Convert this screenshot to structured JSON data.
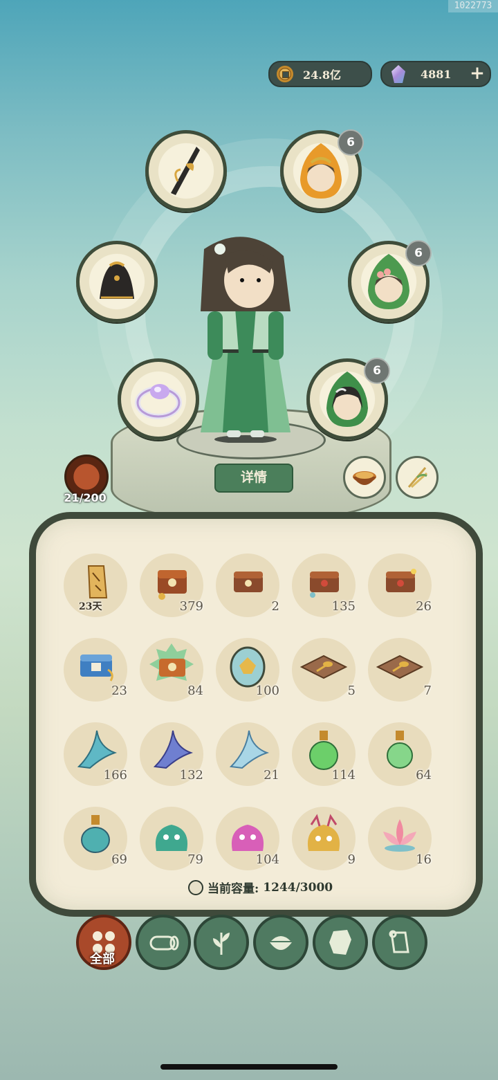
{
  "watermark": "1022773",
  "currency": {
    "coins": {
      "icon": "coin-icon",
      "value": "24.8亿"
    },
    "gems": {
      "icon": "crystal-icon",
      "value": "4881"
    },
    "add": "+"
  },
  "equipment": {
    "weapon": {
      "icon": "sword-icon"
    },
    "armor": {
      "icon": "cloak-icon"
    },
    "accessory": {
      "icon": "ring-icon"
    },
    "pets": [
      {
        "icon": "pet-orange-icon",
        "badge": "6"
      },
      {
        "icon": "pet-green-flower-icon",
        "badge": "6"
      },
      {
        "icon": "pet-green-hair-icon",
        "badge": "6"
      }
    ]
  },
  "detail_button": "详情",
  "power": {
    "icon": "flame-beast-icon",
    "text": "21/200"
  },
  "side_slots": [
    {
      "icon": "food-bowl-icon"
    },
    {
      "icon": "bamboo-icon"
    }
  ],
  "bag": {
    "items": [
      {
        "icon": "scroll-icon",
        "count": "23天"
      },
      {
        "icon": "chest-icon",
        "count": "379"
      },
      {
        "icon": "chest-icon",
        "count": "2"
      },
      {
        "icon": "chest-icon",
        "count": "135"
      },
      {
        "icon": "chest-icon",
        "count": "26"
      },
      {
        "icon": "blue-chest-icon",
        "count": "23"
      },
      {
        "icon": "orange-chest-icon",
        "count": "84"
      },
      {
        "icon": "egg-icon",
        "count": "100"
      },
      {
        "icon": "tray-icon",
        "count": "5"
      },
      {
        "icon": "tray-icon",
        "count": "7"
      },
      {
        "icon": "spirit-fish-icon",
        "count": "166"
      },
      {
        "icon": "spirit-fish-icon",
        "count": "132"
      },
      {
        "icon": "spirit-fish-icon",
        "count": "21"
      },
      {
        "icon": "green-potion-icon",
        "count": "114"
      },
      {
        "icon": "green-potion-icon",
        "count": "64"
      },
      {
        "icon": "teal-potion-icon",
        "count": "69"
      },
      {
        "icon": "green-spirit-icon",
        "count": "79"
      },
      {
        "icon": "pink-spirit-icon",
        "count": "104"
      },
      {
        "icon": "gold-spirit-icon",
        "count": "9"
      },
      {
        "icon": "lotus-icon",
        "count": "16"
      }
    ],
    "capacity_label": "当前容量:",
    "capacity_value": "1244/3000"
  },
  "tabs": [
    {
      "name": "all",
      "label": "全部",
      "icon": "grid-dots-icon",
      "active": true
    },
    {
      "name": "wood",
      "icon": "log-icon"
    },
    {
      "name": "herb",
      "icon": "leaf-icon"
    },
    {
      "name": "food",
      "icon": "rice-bowl-icon"
    },
    {
      "name": "material",
      "icon": "ore-icon"
    },
    {
      "name": "scroll",
      "icon": "paper-scroll-icon"
    }
  ],
  "colors": {
    "panel_border": "#3f4a3b",
    "tab_active": "#a9492a",
    "tab": "#4f7a61"
  }
}
